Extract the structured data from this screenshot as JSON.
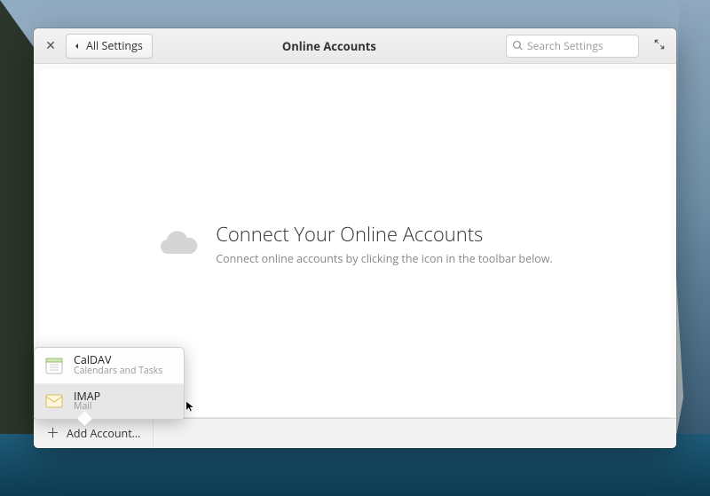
{
  "header": {
    "back_label": "All Settings",
    "title": "Online Accounts",
    "search_placeholder": "Search Settings"
  },
  "empty_state": {
    "heading": "Connect Your Online Accounts",
    "subtext": "Connect online accounts by clicking the icon in the toolbar below."
  },
  "footer": {
    "add_label": "Add Account…"
  },
  "popover": {
    "items": [
      {
        "title": "CalDAV",
        "subtitle": "Calendars and Tasks",
        "icon": "calendar-icon"
      },
      {
        "title": "IMAP",
        "subtitle": "Mail",
        "icon": "mail-icon"
      }
    ],
    "hover_index": 1
  }
}
